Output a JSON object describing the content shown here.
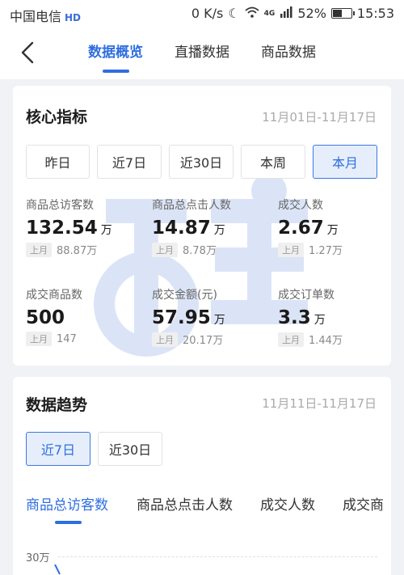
{
  "status_bar": {
    "carrier": "中国电信",
    "hd_badge": "HD",
    "speed": "0 K/s",
    "network": "4G",
    "battery": "52%",
    "battery_level": 0.52,
    "time": "15:53"
  },
  "nav": {
    "tabs": [
      {
        "label": "数据概览",
        "active": true
      },
      {
        "label": "直播数据",
        "active": false
      },
      {
        "label": "商品数据",
        "active": false
      }
    ]
  },
  "core": {
    "title": "核心指标",
    "date_range": "11月01日-11月17日",
    "periods": [
      {
        "label": "昨日",
        "active": false
      },
      {
        "label": "近7日",
        "active": false
      },
      {
        "label": "近30日",
        "active": false
      },
      {
        "label": "本周",
        "active": false
      },
      {
        "label": "本月",
        "active": true
      }
    ],
    "metrics": [
      {
        "label": "商品总访客数",
        "value": "132.54",
        "unit": "万",
        "prev_tag": "上月",
        "prev_value": "88.87万"
      },
      {
        "label": "商品总点击人数",
        "value": "14.87",
        "unit": "万",
        "prev_tag": "上月",
        "prev_value": "8.78万"
      },
      {
        "label": "成交人数",
        "value": "2.67",
        "unit": "万",
        "prev_tag": "上月",
        "prev_value": "1.27万"
      },
      {
        "label": "成交商品数",
        "value": "500",
        "unit": "",
        "prev_tag": "上月",
        "prev_value": "147"
      },
      {
        "label": "成交金额(元)",
        "value": "57.95",
        "unit": "万",
        "prev_tag": "上月",
        "prev_value": "20.17万"
      },
      {
        "label": "成交订单数",
        "value": "3.3",
        "unit": "万",
        "prev_tag": "上月",
        "prev_value": "1.44万"
      }
    ]
  },
  "trend": {
    "title": "数据趋势",
    "date_range": "11月11日-11月17日",
    "periods": [
      {
        "label": "近7日",
        "active": true
      },
      {
        "label": "近30日",
        "active": false
      }
    ],
    "metric_tabs": [
      {
        "label": "商品总访客数",
        "active": true
      },
      {
        "label": "商品总点击人数",
        "active": false
      },
      {
        "label": "成交人数",
        "active": false
      },
      {
        "label": "成交商",
        "active": false
      }
    ],
    "y_tick": "30万"
  },
  "colors": {
    "accent": "#2f6ee0",
    "page_bg": "#f1f2f6"
  }
}
